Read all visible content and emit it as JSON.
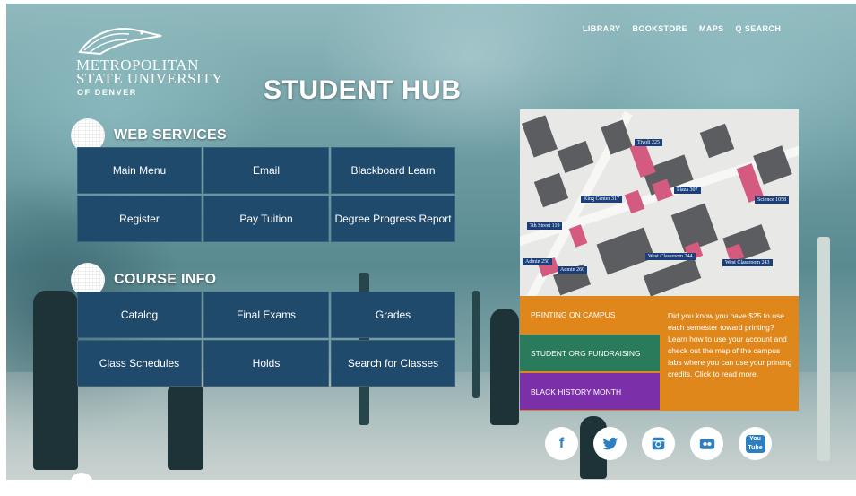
{
  "colors": {
    "tile": "#1f4a6c",
    "promo_orange": "#e0871c",
    "green": "#2a7a5c",
    "purple": "#7b2fa8",
    "accent_icon": "#2e7fbf"
  },
  "logo": {
    "line1": "METROPOLITAN",
    "line2": "STATE UNIVERSITY",
    "line3": "OF DENVER"
  },
  "nav": {
    "library": "LIBRARY",
    "bookstore": "BOOKSTORE",
    "maps": "MAPS",
    "search": "Q SEARCH"
  },
  "hero": {
    "title": "STUDENT HUB"
  },
  "web_services": {
    "title": "WEB SERVICES",
    "tiles": [
      "Main Menu",
      "Email",
      "Blackboard Learn",
      "Register",
      "Pay Tuition",
      "Degree Progress Report"
    ]
  },
  "course_info": {
    "title": "COURSE INFO",
    "tiles": [
      "Catalog",
      "Final Exams",
      "Grades",
      "Class Schedules",
      "Holds",
      "Search for Classes"
    ]
  },
  "map": {
    "labels": [
      "Tivoli 225",
      "King Center 317",
      "Plaza 307",
      "Science 1058",
      "7th Street 119",
      "Admin 250",
      "Admin 260",
      "West Classroom 244",
      "West Classroom 243"
    ]
  },
  "promo": {
    "items": [
      "PRINTING ON CAMPUS",
      "STUDENT ORG FUNDRAISING",
      "BLACK HISTORY MONTH"
    ],
    "text": "Did you know you have $25 to use each semester toward printing? Learn how to use your account and check out the map of the campus labs where you can use your printing credits. Click to read more."
  },
  "social": {
    "icons": [
      "facebook-icon",
      "twitter-icon",
      "instagram-icon",
      "flickr-icon",
      "youtube-icon"
    ],
    "youtube_text": "You Tube"
  }
}
